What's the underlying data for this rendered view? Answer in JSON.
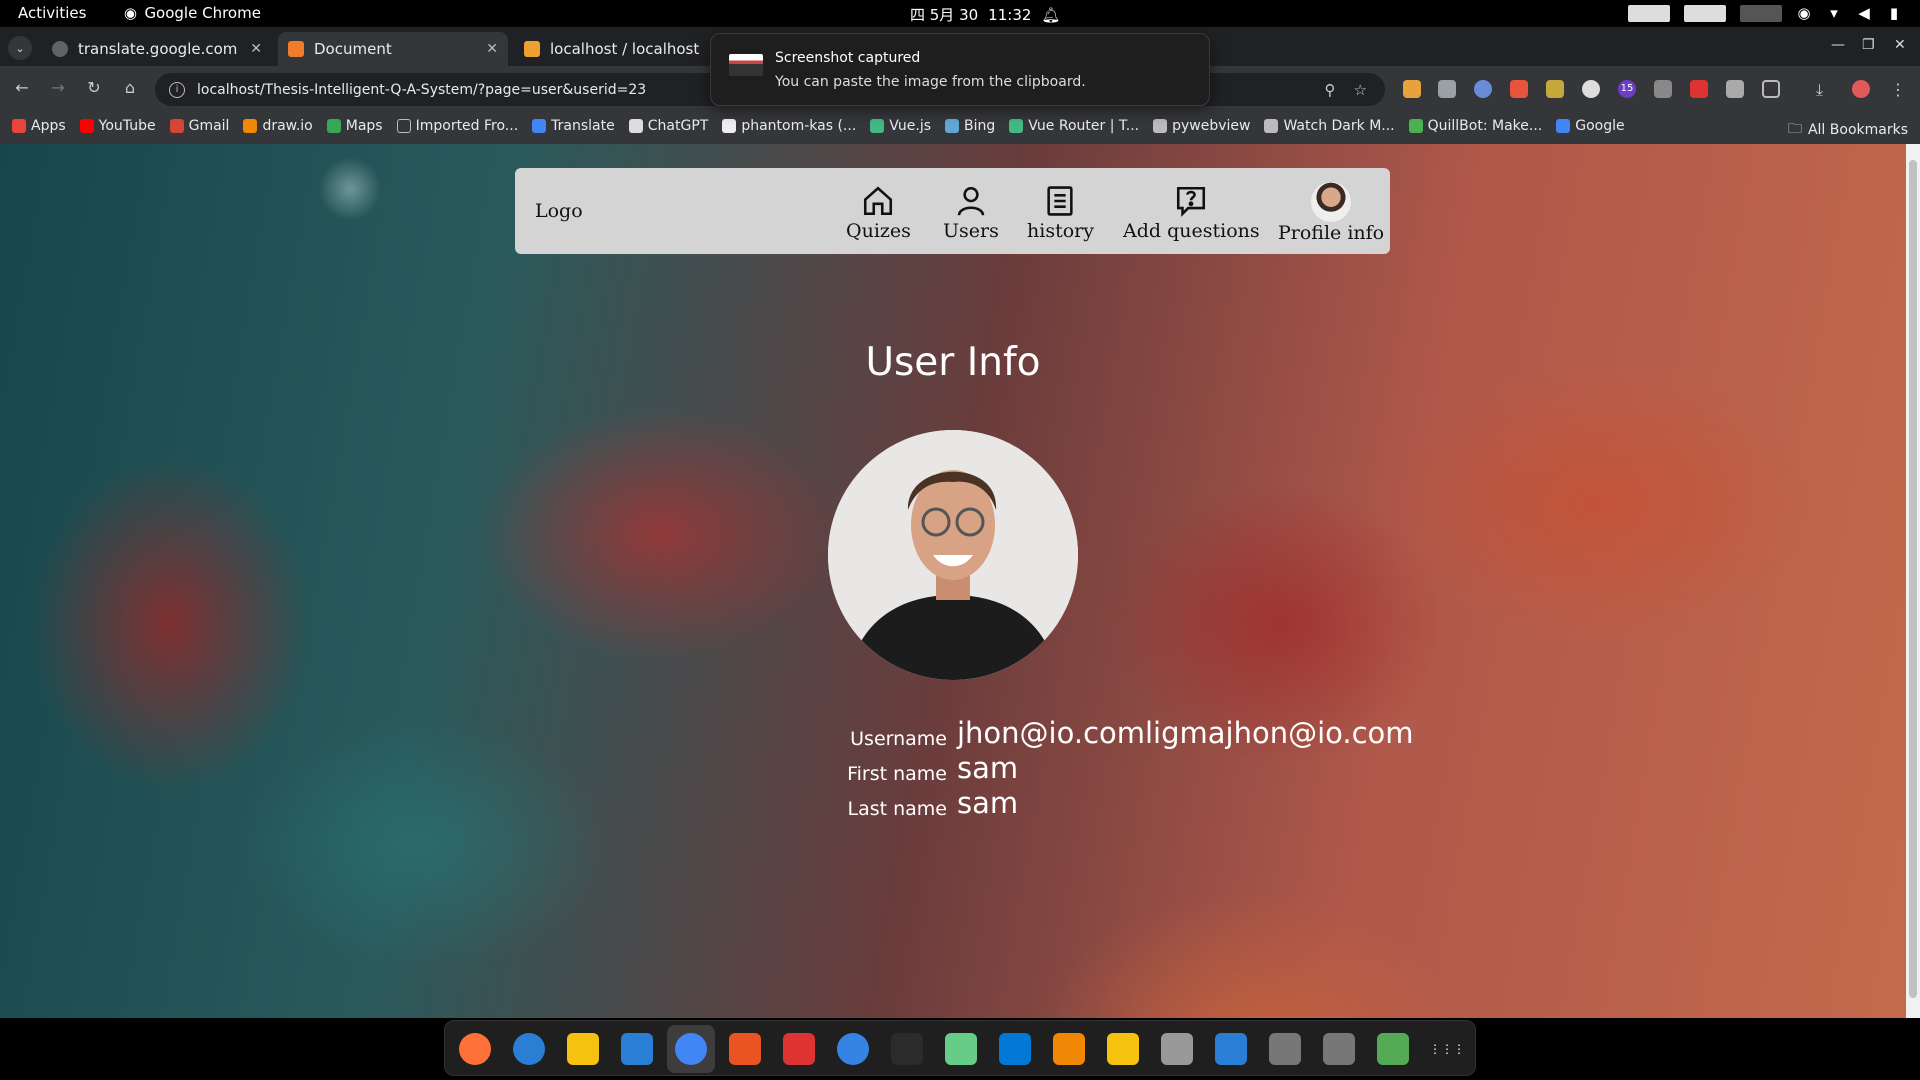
{
  "system": {
    "activities": "Activities",
    "app_name": "Google Chrome",
    "date": "四 5月 30",
    "time": "11:32"
  },
  "browser": {
    "tabs": [
      {
        "title": "translate.google.com",
        "active": false
      },
      {
        "title": "Document",
        "active": true
      },
      {
        "title": "localhost / localhost / q",
        "active": false
      }
    ],
    "url": "localhost/Thesis-Intelligent-Q-A-System/?page=user&userid=23",
    "extension_badge": "15",
    "bookmarks": [
      {
        "label": "Apps",
        "icon": "apps-grid-icon",
        "color": "#e8453c"
      },
      {
        "label": "YouTube",
        "icon": "youtube-icon",
        "color": "#ff0000"
      },
      {
        "label": "Gmail",
        "icon": "gmail-icon",
        "color": "#d44638"
      },
      {
        "label": "draw.io",
        "icon": "drawio-icon",
        "color": "#f08705"
      },
      {
        "label": "Maps",
        "icon": "maps-icon",
        "color": "#34a853"
      },
      {
        "label": "Imported Fro...",
        "icon": "folder-icon",
        "color": "#bbbbbb"
      },
      {
        "label": "Translate",
        "icon": "translate-icon",
        "color": "#4285f4"
      },
      {
        "label": "ChatGPT",
        "icon": "chatgpt-icon",
        "color": "#dddddd"
      },
      {
        "label": "phantom-kas (...",
        "icon": "github-icon",
        "color": "#eeeeee"
      },
      {
        "label": "Vue.js",
        "icon": "vue-icon",
        "color": "#42b883"
      },
      {
        "label": "Bing",
        "icon": "bing-icon",
        "color": "#5fa8d3"
      },
      {
        "label": "Vue Router | T...",
        "icon": "vue-icon",
        "color": "#42b883"
      },
      {
        "label": "pywebview",
        "icon": "globe-icon",
        "color": "#bbbbbb"
      },
      {
        "label": "Watch Dark M...",
        "icon": "watch-icon",
        "color": "#bbbbbb"
      },
      {
        "label": "QuillBot: Make...",
        "icon": "quillbot-icon",
        "color": "#4caf50"
      },
      {
        "label": "Google",
        "icon": "google-icon",
        "color": "#4285f4"
      }
    ],
    "all_bookmarks": "All Bookmarks"
  },
  "notification": {
    "title": "Screenshot captured",
    "body": "You can paste the image from the clipboard."
  },
  "navbar": {
    "logo": "Logo",
    "items": [
      {
        "label": "Quizes",
        "icon": "home-icon"
      },
      {
        "label": "Users",
        "icon": "user-icon"
      },
      {
        "label": "history",
        "icon": "list-icon"
      },
      {
        "label": "Add questions",
        "icon": "question-icon"
      },
      {
        "label": "Profile info",
        "icon": "avatar"
      }
    ]
  },
  "user_info": {
    "title": "User Info",
    "fields": [
      {
        "label": "Username",
        "value": "jhon@io.comligmajhon@io.com"
      },
      {
        "label": "First name",
        "value": "sam"
      },
      {
        "label": "Last name",
        "value": "sam"
      }
    ]
  },
  "dock": [
    {
      "name": "firefox-icon",
      "color": "#ff7139"
    },
    {
      "name": "thunderbird-icon",
      "color": "#2a7fd4"
    },
    {
      "name": "rhythmbox-icon",
      "color": "#f5c211"
    },
    {
      "name": "writer-icon",
      "color": "#2a7fd4"
    },
    {
      "name": "chrome-icon",
      "color": "#4285f4"
    },
    {
      "name": "software-icon",
      "color": "#e95420"
    },
    {
      "name": "download-manager-icon",
      "color": "#d33"
    },
    {
      "name": "help-icon",
      "color": "#3584e4"
    },
    {
      "name": "terminal-icon",
      "color": "#2b2b2b"
    },
    {
      "name": "settings-toggle-icon",
      "color": "#6c8"
    },
    {
      "name": "vscode-icon",
      "color": "#0078d4"
    },
    {
      "name": "vlc-icon",
      "color": "#f08705"
    },
    {
      "name": "sticky-notes-icon",
      "color": "#f5c211"
    },
    {
      "name": "files-icon",
      "color": "#999999"
    },
    {
      "name": "app-center-icon",
      "color": "#2a7fd4"
    },
    {
      "name": "disk-icon-1",
      "color": "#777777"
    },
    {
      "name": "disk-icon-2",
      "color": "#777777"
    },
    {
      "name": "trash-icon",
      "color": "#5a5"
    },
    {
      "name": "show-apps-icon",
      "color": "#ffffff"
    }
  ]
}
